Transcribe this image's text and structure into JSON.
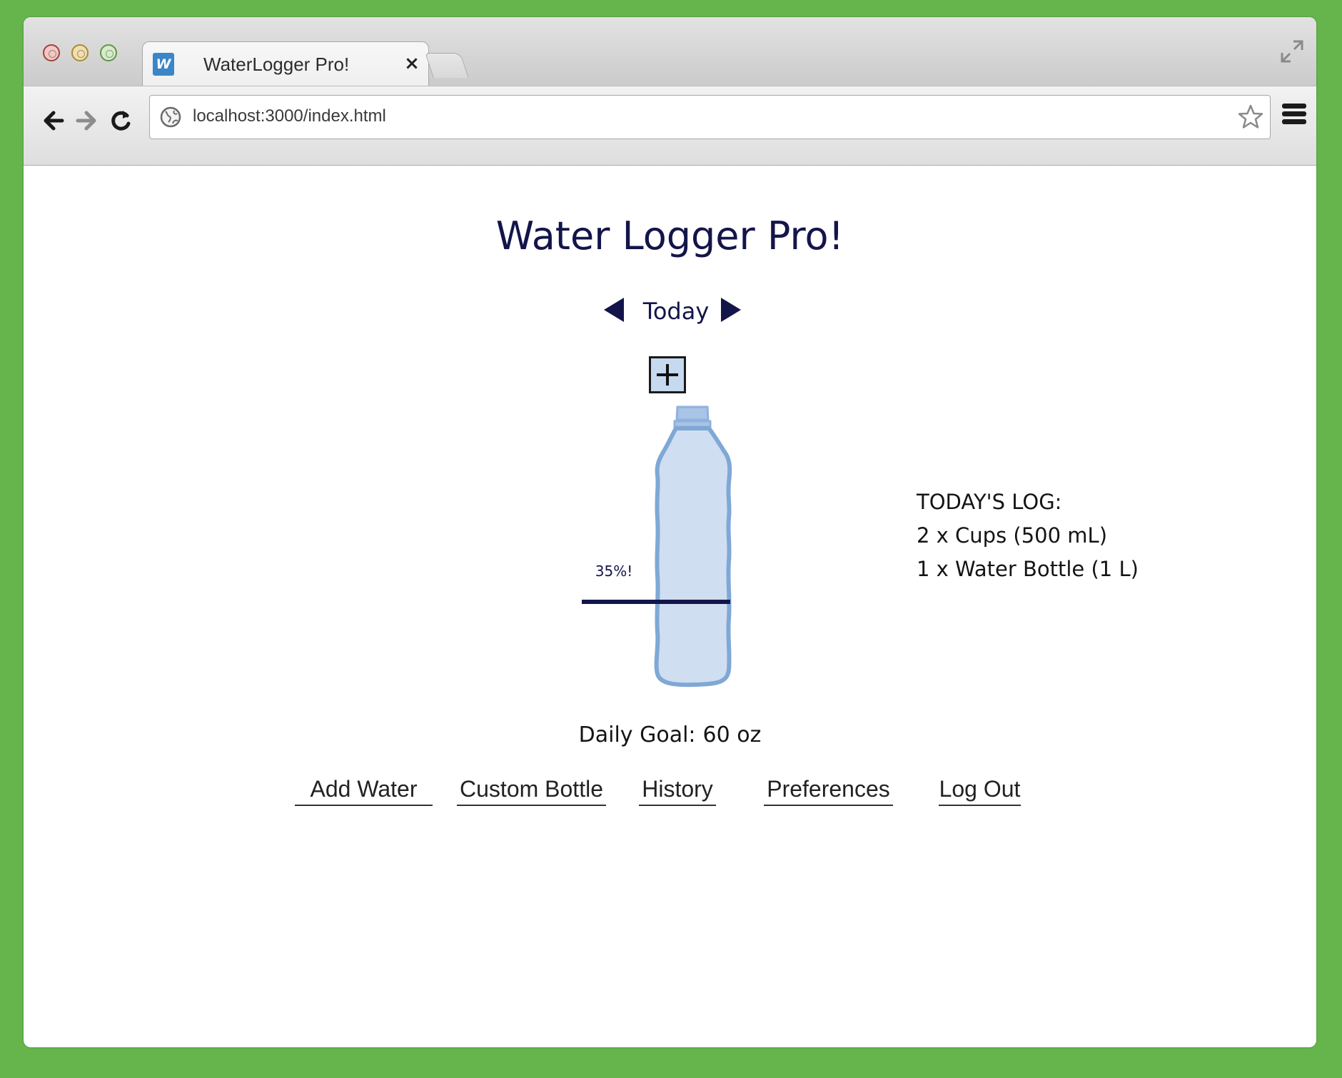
{
  "browser": {
    "tab_title": "WaterLogger Pro!",
    "tab_favicon_letter": "W",
    "tab_close": "×",
    "url": "localhost:3000/index.html"
  },
  "app": {
    "title": "Water Logger Pro!",
    "day_label": "Today",
    "progress": {
      "label": "35%!",
      "value": 0.35
    },
    "log": {
      "heading": "TODAY'S LOG:",
      "entries": [
        "2 x Cups (500 mL)",
        "1 x Water Bottle (1 L)"
      ]
    },
    "goal": {
      "label": "Daily Goal:",
      "value": "60 oz"
    },
    "menu": [
      "Add Water",
      "Custom Bottle",
      "History",
      "Preferences",
      "Log Out"
    ]
  },
  "colors": {
    "background": "#66b54c",
    "text_primary": "#13154a",
    "bottle_fill": "#cfdef0",
    "bottle_outline": "#7fa8d6",
    "favicon": "#3a86c7"
  },
  "icons": [
    "close-icon",
    "back-arrow-icon",
    "forward-arrow-icon",
    "reload-icon",
    "globe-icon",
    "star-icon",
    "menu-icon",
    "fullscreen-icon",
    "prev-day-icon",
    "next-day-icon",
    "plus-icon",
    "water-bottle-icon"
  ]
}
